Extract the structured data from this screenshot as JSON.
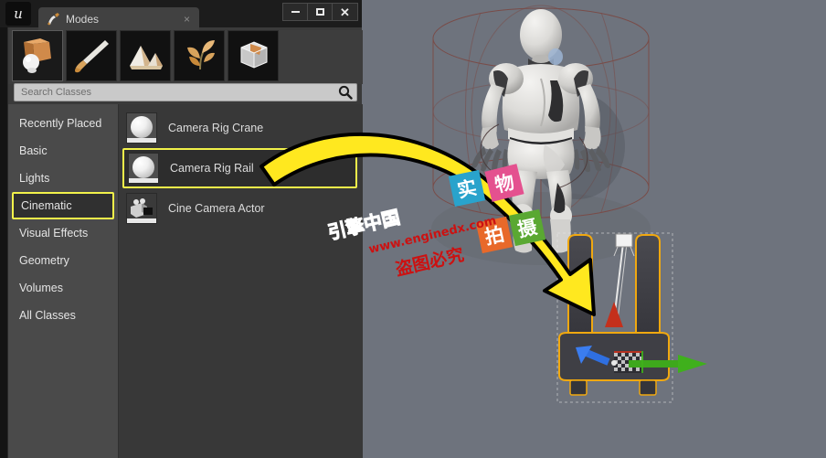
{
  "window": {
    "app_logo": "unreal-engine-logo",
    "controls": [
      {
        "name": "minimize-button",
        "glyph": "minimize-icon"
      },
      {
        "name": "maximize-button",
        "glyph": "maximize-icon"
      },
      {
        "name": "close-button",
        "glyph": "close-icon"
      }
    ]
  },
  "tab": {
    "label": "Modes",
    "icon": "modes-brush-icon",
    "close_label": "×"
  },
  "mode_toolbar": {
    "buttons": [
      {
        "name": "place-mode",
        "icon": "place-box-sphere-icon",
        "active": true
      },
      {
        "name": "paint-mode",
        "icon": "paint-brush-icon",
        "active": false
      },
      {
        "name": "landscape-mode",
        "icon": "landscape-mountain-icon",
        "active": false
      },
      {
        "name": "foliage-mode",
        "icon": "foliage-leaf-icon",
        "active": false
      },
      {
        "name": "geometry-edit-mode",
        "icon": "geometry-wireframe-box-icon",
        "active": false
      }
    ]
  },
  "search": {
    "placeholder": "Search Classes",
    "value": "",
    "icon": "search-magnifier-icon"
  },
  "categories": [
    {
      "label": "Recently Placed",
      "selected": false
    },
    {
      "label": "Basic",
      "selected": false
    },
    {
      "label": "Lights",
      "selected": false
    },
    {
      "label": "Cinematic",
      "selected": true
    },
    {
      "label": "Visual Effects",
      "selected": false
    },
    {
      "label": "Geometry",
      "selected": false
    },
    {
      "label": "Volumes",
      "selected": false
    },
    {
      "label": "All Classes",
      "selected": false
    }
  ],
  "items": [
    {
      "label": "Camera Rig Crane",
      "thumb": "sphere-thumbnail",
      "highlighted": false
    },
    {
      "label": "Camera Rig Rail",
      "thumb": "sphere-thumbnail",
      "highlighted": true
    },
    {
      "label": "Cine Camera Actor",
      "thumb": "cine-camera-thumbnail",
      "highlighted": false
    }
  ],
  "viewport": {
    "background_color": "#6e737d",
    "selected_actor_outline_color": "#f0a810",
    "character": "mannequin-character",
    "gizmo": {
      "x_axis_color": "#cc2a18",
      "y_axis_color": "#35c21a",
      "z_axis_color": "#2a6ee8"
    }
  },
  "annotation": {
    "arrow": {
      "name": "instruction-arrow",
      "fill_color": "#ffe81f",
      "stroke_color": "#000000"
    }
  },
  "watermarks": {
    "brand": "引擎中国",
    "url": "www.enginedx.com",
    "warning": "盗图必究",
    "tiles": [
      {
        "char": "实",
        "color": "#29a3cc",
        "name": "watermark-tile-shi"
      },
      {
        "char": "物",
        "color": "#e4518f",
        "name": "watermark-tile-wu"
      },
      {
        "char": "拍",
        "color": "#e8692a",
        "name": "watermark-tile-pai"
      },
      {
        "char": "摄",
        "color": "#5aa832",
        "name": "watermark-tile-she"
      }
    ]
  }
}
